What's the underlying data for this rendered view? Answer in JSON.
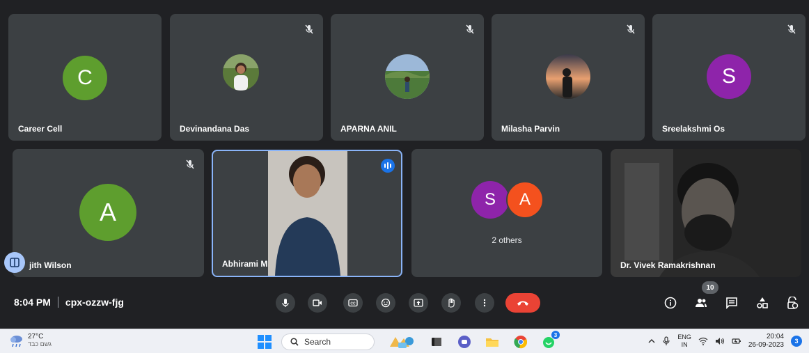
{
  "tiles_row1": [
    {
      "name": "Career Cell",
      "initial": "C",
      "avatar_color": "#5e9e2e",
      "muted": false
    },
    {
      "name": "Devinandana Das",
      "initial": "",
      "avatar_color": "",
      "muted": true
    },
    {
      "name": "APARNA ANIL",
      "initial": "",
      "avatar_color": "",
      "muted": true
    },
    {
      "name": "Milasha Parvin",
      "initial": "",
      "avatar_color": "",
      "muted": true
    },
    {
      "name": "Sreelakshmi Os",
      "initial": "S",
      "avatar_color": "#8e24aa",
      "muted": true
    }
  ],
  "tiles_row2": {
    "ajith": {
      "name": "jith Wilson",
      "initial": "A",
      "avatar_color": "#5e9e2e"
    },
    "abhirami": {
      "name": "Abhirami M"
    },
    "others": {
      "label": "2 others",
      "initials": [
        "S",
        "A"
      ],
      "colors": [
        "#8e24aa",
        "#f4511e"
      ]
    },
    "vivek": {
      "name": "Dr. Vivek Ramakrishnan"
    }
  },
  "controls": {
    "time": "8:04 PM",
    "meeting_code": "cpx-ozzw-fjg",
    "people_count": "10"
  },
  "taskbar": {
    "temperature": "27°C",
    "weather": "גשם כבד",
    "search_label": "Search",
    "lang_top": "ENG",
    "lang_bottom": "IN",
    "time": "20:04",
    "date": "26-09-2023",
    "notifications": "3",
    "whatsapp_badge": "3"
  },
  "colors": {
    "accent": "#8ab4f8",
    "end_call": "#ea4335",
    "tile_bg": "#3c4043",
    "page_bg": "#202124"
  }
}
